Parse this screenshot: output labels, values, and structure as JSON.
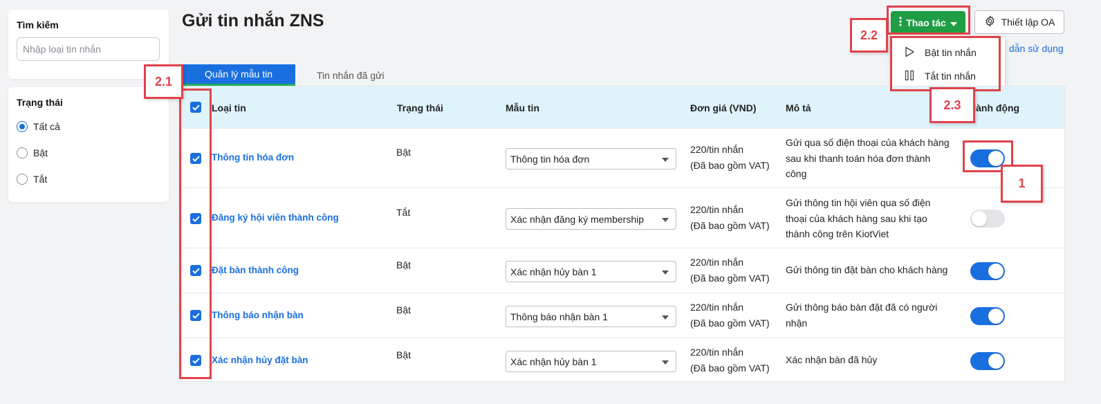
{
  "page": {
    "title": "Gửi tin nhắn ZNS"
  },
  "search": {
    "title": "Tìm kiếm",
    "placeholder": "Nhập loại tin nhắn"
  },
  "status_filter": {
    "title": "Trạng thái",
    "options": [
      {
        "label": "Tất cả",
        "selected": true
      },
      {
        "label": "Bật",
        "selected": false
      },
      {
        "label": "Tắt",
        "selected": false
      }
    ]
  },
  "header": {
    "actions_label": "Thao tác",
    "setup_label": "Thiết lập OA",
    "help_link": "dẫn sử dụng"
  },
  "dropdown": {
    "items": [
      {
        "label": "Bật tin nhắn",
        "icon": "play-icon"
      },
      {
        "label": "Tắt tin nhắn",
        "icon": "pause-icon"
      }
    ]
  },
  "tabs": [
    {
      "label": "Quản lý mẫu tin",
      "active": true
    },
    {
      "label": "Tin nhắn đã gửi",
      "active": false
    }
  ],
  "table": {
    "columns": [
      "Loại tin",
      "Trạng thái",
      "Mẫu tin",
      "Đơn giá (VND)",
      "Mô tả",
      "Hành động"
    ],
    "rows": [
      {
        "name": "Thông tin hóa đơn",
        "status": "Bật",
        "template": "Thông tin hóa đơn",
        "price": "220/tin nhắn",
        "price_note": "(Đã bao gồm VAT)",
        "desc": [
          "Gửi qua số điện thoại của khách hàng",
          "sau khi thanh toán hóa đơn thành",
          "công"
        ],
        "enabled": true
      },
      {
        "name": "Đăng ký hội viên thành công",
        "status": "Tắt",
        "template": "Xác nhận đăng ký membership",
        "price": "220/tin nhắn",
        "price_note": "(Đã bao gồm VAT)",
        "desc": [
          "Gửi thông tin hội viên qua số điện",
          "thoại của khách hàng sau khi tạo",
          "thành công trên KiotViet"
        ],
        "enabled": false
      },
      {
        "name": "Đặt bàn thành công",
        "status": "Bật",
        "template": "Xác nhận hủy bàn 1",
        "price": "220/tin nhắn",
        "price_note": "(Đã bao gồm VAT)",
        "desc": [
          "Gửi thông tin đặt bàn cho khách hàng"
        ],
        "enabled": true
      },
      {
        "name": "Thông báo nhận bàn",
        "status": "Bật",
        "template": "Thông báo nhận bàn 1",
        "price": "220/tin nhắn",
        "price_note": "(Đã bao gồm VAT)",
        "desc": [
          "Gửi thông báo bàn đặt đã có người",
          "nhận"
        ],
        "enabled": true
      },
      {
        "name": "Xác nhận hủy đặt bàn",
        "status": "Bật",
        "template": "Xác nhận hủy bàn 1",
        "price": "220/tin nhắn",
        "price_note": "(Đã bao gồm VAT)",
        "desc": [
          "Xác nhận bàn đã hủy"
        ],
        "enabled": true
      }
    ]
  },
  "annotations": [
    "2.1",
    "2.2",
    "2.3",
    "1"
  ],
  "colors": {
    "primary": "#1a6fe0",
    "green": "#1f9d45",
    "annotation": "#e0424b",
    "header_bg": "#dff3fb"
  }
}
